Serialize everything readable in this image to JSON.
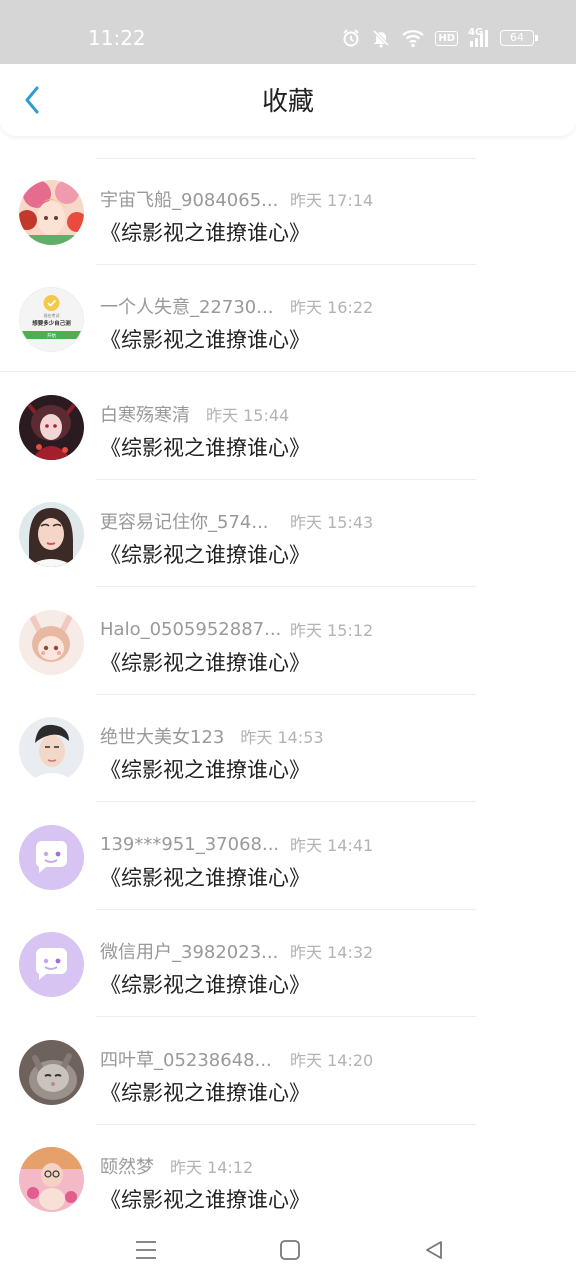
{
  "status_bar": {
    "time": "11:22",
    "network_label": "4G",
    "hd_label": "HD",
    "battery_level": "64",
    "icons": [
      "alarm-icon",
      "mute-icon",
      "wifi-icon",
      "hd-icon",
      "signal-icon",
      "battery-icon"
    ]
  },
  "header": {
    "title": "收藏",
    "back_icon": "chevron-left-icon",
    "accent_color": "#2d9cdb"
  },
  "items": [
    {
      "user": "宇宙飞船_9084065...",
      "time": "昨天 17:14",
      "title": "《综影视之谁撩谁心》"
    },
    {
      "user": "一个人失意_22730...",
      "time": "昨天 16:22",
      "title": "《综影视之谁撩谁心》"
    },
    {
      "user": "白寒殇寒清",
      "time": "昨天 15:44",
      "title": "《综影视之谁撩谁心》"
    },
    {
      "user": "更容易记住你_574...",
      "time": "昨天 15:43",
      "title": "《综影视之谁撩谁心》"
    },
    {
      "user": "Halo_0505952887...",
      "time": "昨天 15:12",
      "title": "《综影视之谁撩谁心》"
    },
    {
      "user": "绝世大美女123",
      "time": "昨天 14:53",
      "title": "《综影视之谁撩谁心》"
    },
    {
      "user": "139***951_37068...",
      "time": "昨天 14:41",
      "title": "《综影视之谁撩谁心》"
    },
    {
      "user": "微信用户_3982023...",
      "time": "昨天 14:32",
      "title": "《综影视之谁撩谁心》"
    },
    {
      "user": "四叶草_05238648...",
      "time": "昨天 14:20",
      "title": "《综影视之谁撩谁心》"
    },
    {
      "user": "颐然梦",
      "time": "昨天 14:12",
      "title": "《综影视之谁撩谁心》"
    }
  ],
  "avatar_notice": {
    "line1": "现在考试",
    "line2": "想要多少自己测",
    "button": "开始"
  },
  "nav_bar": {
    "icons": [
      "menu-icon",
      "home-square-icon",
      "back-triangle-icon"
    ]
  }
}
